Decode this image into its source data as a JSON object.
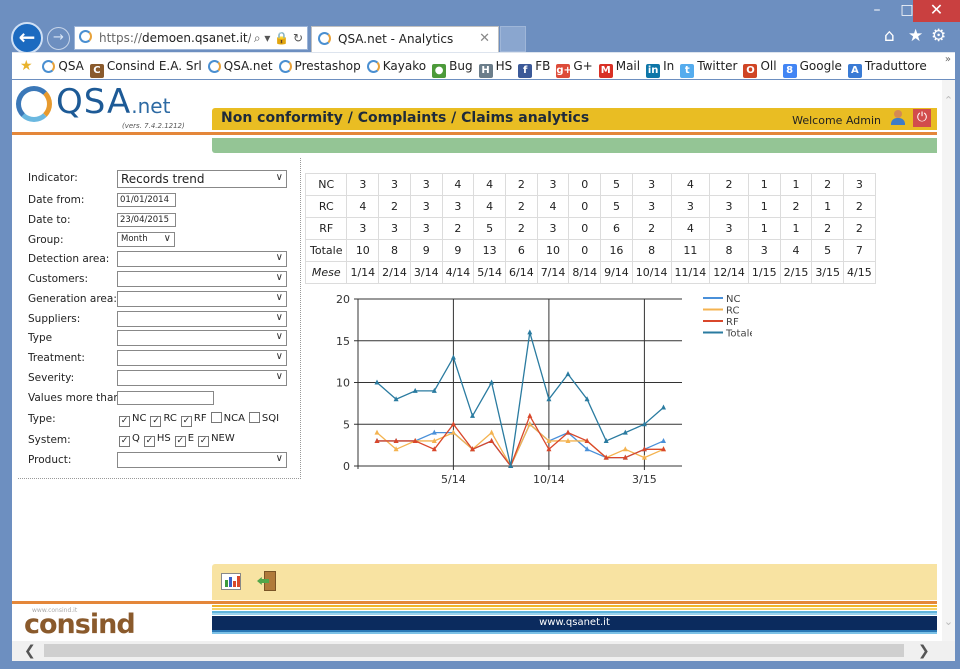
{
  "window": {
    "minimize": "–",
    "maximize": "□",
    "close": "✕"
  },
  "browser": {
    "back_icon": "←",
    "forward_icon": "→",
    "address": {
      "scheme": "https://",
      "host": "demoen.qsanet.it",
      "path": "/pA",
      "tools": "⌕ ▾ 🔒 ↻"
    },
    "tab": {
      "title": "QSA.net - Analytics",
      "close": "✕"
    },
    "toolbar_icons": {
      "home": "⌂",
      "favorites": "★",
      "settings": "⚙"
    },
    "favorites": [
      {
        "label": "QSA",
        "icon": "ie-icon",
        "color": "#4a8fd1",
        "glyph": ""
      },
      {
        "label": "Consind E.A. Srl",
        "icon": "consind-icon",
        "color": "#8a5a2c",
        "glyph": "C"
      },
      {
        "label": "QSA.net",
        "icon": "ie-icon",
        "color": "#4a8fd1",
        "glyph": ""
      },
      {
        "label": "Prestashop",
        "icon": "ie-icon",
        "color": "#4a8fd1",
        "glyph": ""
      },
      {
        "label": "Kayako",
        "icon": "ie-icon",
        "color": "#4a8fd1",
        "glyph": ""
      },
      {
        "label": "Bug",
        "icon": "bug-icon",
        "color": "#4c9a3a",
        "glyph": "●"
      },
      {
        "label": "HS",
        "icon": "hs-icon",
        "color": "#6b7d8a",
        "glyph": "H"
      },
      {
        "label": "FB",
        "icon": "facebook-icon",
        "color": "#3b5998",
        "glyph": "f"
      },
      {
        "label": "G+",
        "icon": "googleplus-icon",
        "color": "#dd4b39",
        "glyph": "g+"
      },
      {
        "label": "Mail",
        "icon": "gmail-icon",
        "color": "#d93025",
        "glyph": "M"
      },
      {
        "label": "In",
        "icon": "linkedin-icon",
        "color": "#0e76a8",
        "glyph": "in"
      },
      {
        "label": "Twitter",
        "icon": "twitter-icon",
        "color": "#55acee",
        "glyph": "t"
      },
      {
        "label": "Oll",
        "icon": "office-icon",
        "color": "#d04525",
        "glyph": "O"
      },
      {
        "label": "Google",
        "icon": "google-icon",
        "color": "#4285f4",
        "glyph": "8"
      },
      {
        "label": "Traduttore",
        "icon": "translator-icon",
        "color": "#3a7bd5",
        "glyph": "A"
      }
    ],
    "favorites_more": "»"
  },
  "app": {
    "logo": {
      "name": "QSA",
      "suffix": ".net",
      "version": "(vers. 7.4.2.1212)"
    },
    "title": "Non conformity / Complaints / Claims analytics",
    "welcome": "Welcome Admin",
    "power_icon": "⏻",
    "footer_url": "www.qsanet.it",
    "consind": {
      "url": "www.consind.it",
      "name": "consind"
    }
  },
  "filters": {
    "indicator": {
      "label": "Indicator:",
      "value": "Records trend"
    },
    "date_from": {
      "label": "Date from:",
      "value": "01/01/2014"
    },
    "date_to": {
      "label": "Date to:",
      "value": "23/04/2015"
    },
    "group": {
      "label": "Group:",
      "value": "Month"
    },
    "detection_area": {
      "label": "Detection area:",
      "value": ""
    },
    "customers": {
      "label": "Customers:",
      "value": ""
    },
    "generation_area": {
      "label": "Generation area:",
      "value": ""
    },
    "suppliers": {
      "label": "Suppliers:",
      "value": ""
    },
    "type_select": {
      "label": "Type",
      "value": ""
    },
    "treatment": {
      "label": "Treatment:",
      "value": ""
    },
    "severity": {
      "label": "Severity:",
      "value": ""
    },
    "values_more_than": {
      "label": "Values more than:",
      "value": ""
    },
    "type_checks": {
      "label": "Type:",
      "options": [
        {
          "label": "NC",
          "checked": true
        },
        {
          "label": "RC",
          "checked": true
        },
        {
          "label": "RF",
          "checked": true
        },
        {
          "label": "NCA",
          "checked": false
        },
        {
          "label": "SQI",
          "checked": false
        }
      ]
    },
    "system_checks": {
      "label": "System:",
      "options": [
        {
          "label": "Q",
          "checked": true
        },
        {
          "label": "HS",
          "checked": true
        },
        {
          "label": "E",
          "checked": true
        },
        {
          "label": "NEW",
          "checked": true
        }
      ]
    },
    "product": {
      "label": "Product:",
      "value": ""
    },
    "chevron": "∨",
    "check_mark": "✓"
  },
  "table": {
    "rows": [
      {
        "label": "NC",
        "values": [
          "3",
          "3",
          "3",
          "4",
          "4",
          "2",
          "3",
          "0",
          "5",
          "3",
          "4",
          "2",
          "1",
          "1",
          "2",
          "3"
        ]
      },
      {
        "label": "RC",
        "values": [
          "4",
          "2",
          "3",
          "3",
          "4",
          "2",
          "4",
          "0",
          "5",
          "3",
          "3",
          "3",
          "1",
          "2",
          "1",
          "2"
        ]
      },
      {
        "label": "RF",
        "values": [
          "3",
          "3",
          "3",
          "2",
          "5",
          "2",
          "3",
          "0",
          "6",
          "2",
          "4",
          "3",
          "1",
          "1",
          "2",
          "2"
        ]
      },
      {
        "label": "Totale",
        "values": [
          "10",
          "8",
          "9",
          "9",
          "13",
          "6",
          "10",
          "0",
          "16",
          "8",
          "11",
          "8",
          "3",
          "4",
          "5",
          "7"
        ]
      }
    ],
    "month_row": {
      "label": "Mese",
      "values": [
        "1/14",
        "2/14",
        "3/14",
        "4/14",
        "5/14",
        "6/14",
        "7/14",
        "8/14",
        "9/14",
        "10/14",
        "11/14",
        "12/14",
        "1/15",
        "2/15",
        "3/15",
        "4/15"
      ]
    }
  },
  "chart_data": {
    "type": "line",
    "title": "",
    "xlabel": "",
    "ylabel": "",
    "x": [
      "1/14",
      "2/14",
      "3/14",
      "4/14",
      "5/14",
      "6/14",
      "7/14",
      "8/14",
      "9/14",
      "10/14",
      "11/14",
      "12/14",
      "1/15",
      "2/15",
      "3/15",
      "4/15"
    ],
    "xtick_labels": [
      "5/14",
      "10/14",
      "3/15"
    ],
    "yticks": [
      0,
      5,
      10,
      15,
      20
    ],
    "ylim": [
      0,
      20
    ],
    "grid": true,
    "legend": "top-right",
    "series": [
      {
        "name": "NC",
        "color": "#4a90d9",
        "values": [
          3,
          3,
          3,
          4,
          4,
          2,
          3,
          0,
          5,
          3,
          4,
          2,
          1,
          1,
          2,
          3
        ]
      },
      {
        "name": "RC",
        "color": "#f4b350",
        "values": [
          4,
          2,
          3,
          3,
          4,
          2,
          4,
          0,
          5,
          3,
          3,
          3,
          1,
          2,
          1,
          2
        ]
      },
      {
        "name": "RF",
        "color": "#d9472b",
        "values": [
          3,
          3,
          3,
          2,
          5,
          2,
          3,
          0,
          6,
          2,
          4,
          3,
          1,
          1,
          2,
          2
        ]
      },
      {
        "name": "Totale",
        "color": "#2a7ba0",
        "values": [
          10,
          8,
          9,
          9,
          13,
          6,
          10,
          0,
          16,
          8,
          11,
          8,
          3,
          4,
          5,
          7
        ]
      }
    ]
  },
  "toolbar": {
    "chart_button": "chart",
    "exit_button": "exit"
  }
}
